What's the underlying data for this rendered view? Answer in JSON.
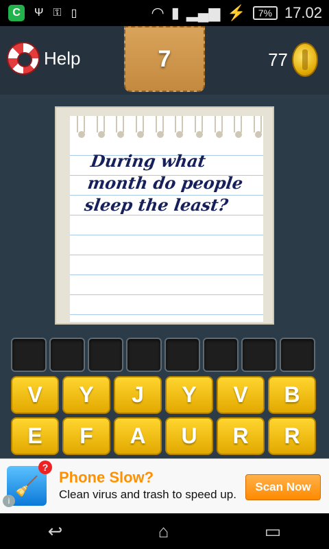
{
  "status_bar": {
    "time": "17.02",
    "battery": "7%"
  },
  "header": {
    "help_label": "Help",
    "level": "7",
    "coins": "77"
  },
  "question": {
    "text": "During what month do people sleep the least?"
  },
  "answer_slots": 8,
  "letters": [
    "V",
    "Y",
    "J",
    "Y",
    "V",
    "B",
    "E",
    "F",
    "A",
    "U",
    "R",
    "R"
  ],
  "ad": {
    "title": "Phone Slow?",
    "subtitle": "Clean virus and trash to speed up.",
    "button": "Scan Now",
    "badge": "?"
  },
  "colors": {
    "key_yellow": "#ffd52f",
    "ad_orange": "#ff9100",
    "status_green": "#22b24c"
  }
}
